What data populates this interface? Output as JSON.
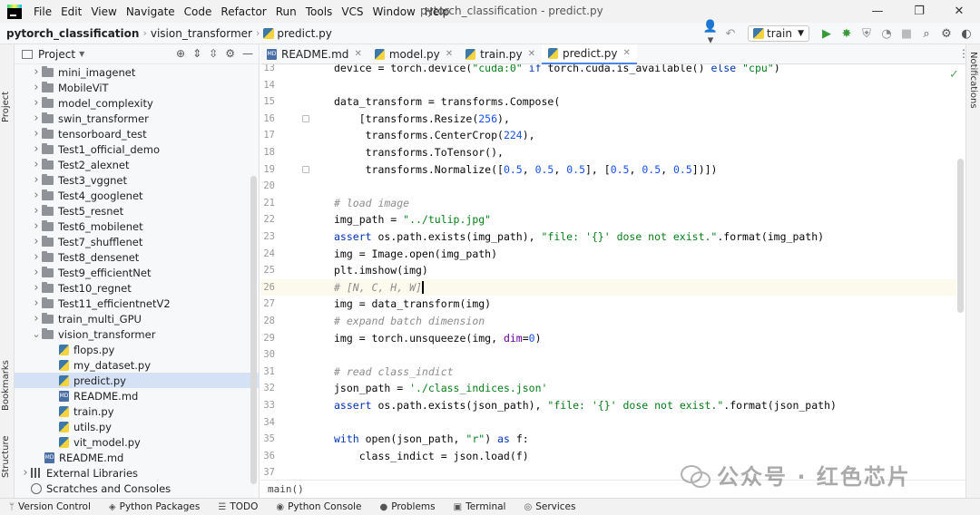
{
  "menubar": {
    "items": [
      "File",
      "Edit",
      "View",
      "Navigate",
      "Code",
      "Refactor",
      "Run",
      "Tools",
      "VCS",
      "Window",
      "Help"
    ],
    "window_title": "pytorch_classification - predict.py"
  },
  "navbar": {
    "project": "pytorch_classification",
    "folder": "vision_transformer",
    "file": "predict.py",
    "run_config": "train"
  },
  "left_strip": {
    "project": "Project",
    "bookmarks": "Bookmarks",
    "structure": "Structure"
  },
  "right_strip": {
    "notifications": "Notifications"
  },
  "project_panel": {
    "title": "Project",
    "tree": [
      {
        "label": "mini_imagenet",
        "type": "folder",
        "depth": 1
      },
      {
        "label": "MobileViT",
        "type": "folder",
        "depth": 1
      },
      {
        "label": "model_complexity",
        "type": "folder",
        "depth": 1
      },
      {
        "label": "swin_transformer",
        "type": "folder",
        "depth": 1
      },
      {
        "label": "tensorboard_test",
        "type": "folder",
        "depth": 1
      },
      {
        "label": "Test1_official_demo",
        "type": "folder",
        "depth": 1
      },
      {
        "label": "Test2_alexnet",
        "type": "folder",
        "depth": 1
      },
      {
        "label": "Test3_vggnet",
        "type": "folder",
        "depth": 1
      },
      {
        "label": "Test4_googlenet",
        "type": "folder",
        "depth": 1
      },
      {
        "label": "Test5_resnet",
        "type": "folder",
        "depth": 1
      },
      {
        "label": "Test6_mobilenet",
        "type": "folder",
        "depth": 1
      },
      {
        "label": "Test7_shufflenet",
        "type": "folder",
        "depth": 1
      },
      {
        "label": "Test8_densenet",
        "type": "folder",
        "depth": 1
      },
      {
        "label": "Test9_efficientNet",
        "type": "folder",
        "depth": 1
      },
      {
        "label": "Test10_regnet",
        "type": "folder",
        "depth": 1
      },
      {
        "label": "Test11_efficientnetV2",
        "type": "folder",
        "depth": 1
      },
      {
        "label": "train_multi_GPU",
        "type": "folder",
        "depth": 1
      },
      {
        "label": "vision_transformer",
        "type": "folder-open",
        "depth": 1
      },
      {
        "label": "flops.py",
        "type": "py",
        "depth": 2
      },
      {
        "label": "my_dataset.py",
        "type": "py",
        "depth": 2
      },
      {
        "label": "predict.py",
        "type": "py",
        "depth": 2,
        "selected": true
      },
      {
        "label": "README.md",
        "type": "md",
        "depth": 2
      },
      {
        "label": "train.py",
        "type": "py",
        "depth": 2
      },
      {
        "label": "utils.py",
        "type": "py",
        "depth": 2
      },
      {
        "label": "vit_model.py",
        "type": "py",
        "depth": 2
      },
      {
        "label": "README.md",
        "type": "md",
        "depth": 1
      },
      {
        "label": "External Libraries",
        "type": "lib",
        "depth": 0
      },
      {
        "label": "Scratches and Consoles",
        "type": "scratch",
        "depth": 0
      }
    ]
  },
  "tabs": [
    {
      "label": "README.md",
      "type": "md",
      "active": false
    },
    {
      "label": "model.py",
      "type": "py",
      "active": false
    },
    {
      "label": "train.py",
      "type": "py",
      "active": false
    },
    {
      "label": "predict.py",
      "type": "py",
      "active": true
    }
  ],
  "editor": {
    "lines": [
      {
        "n": "13",
        "html": "device = torch.device(<span class=\"str\">\"cuda:0\"</span> <span class=\"kw\">if</span> torch.cuda.is_available() <span class=\"kw\">else</span> <span class=\"str\">\"cpu\"</span>)"
      },
      {
        "n": "14",
        "html": ""
      },
      {
        "n": "15",
        "html": "data_transform = transforms.Compose("
      },
      {
        "n": "16",
        "html": "    [transforms.Resize(<span class=\"num\">256</span>),",
        "fold": true
      },
      {
        "n": "17",
        "html": "     transforms.CenterCrop(<span class=\"num\">224</span>),"
      },
      {
        "n": "18",
        "html": "     transforms.ToTensor(),"
      },
      {
        "n": "19",
        "html": "     transforms.Normalize([<span class=\"num\">0.5</span>, <span class=\"num\">0.5</span>, <span class=\"num\">0.5</span>], [<span class=\"num\">0.5</span>, <span class=\"num\">0.5</span>, <span class=\"num\">0.5</span>])])",
        "fold": true
      },
      {
        "n": "20",
        "html": ""
      },
      {
        "n": "21",
        "html": "<span class=\"cmt\"># load image</span>"
      },
      {
        "n": "22",
        "html": "img_path = <span class=\"str\">\"../tulip.jpg\"</span>"
      },
      {
        "n": "23",
        "html": "<span class=\"kw\">assert</span> os.path.exists(img_path), <span class=\"str\">\"file: '{}' dose not exist.\"</span>.format(img_path)"
      },
      {
        "n": "24",
        "html": "img = Image.open(img_path)"
      },
      {
        "n": "25",
        "html": "plt.imshow(img)"
      },
      {
        "n": "26",
        "html": "<span class=\"cmt\"># [N, C, H, W]</span><span class=\"caret\"></span>",
        "current": true
      },
      {
        "n": "27",
        "html": "img = data_transform(img)"
      },
      {
        "n": "28",
        "html": "<span class=\"cmt\"># expand batch dimension</span>"
      },
      {
        "n": "29",
        "html": "img = torch.unsqueeze(img, <span class=\"prm\">dim</span>=<span class=\"num\">0</span>)"
      },
      {
        "n": "30",
        "html": ""
      },
      {
        "n": "31",
        "html": "<span class=\"cmt\"># read class_indict</span>"
      },
      {
        "n": "32",
        "html": "json_path = <span class=\"str\">'./class_indices.json'</span>"
      },
      {
        "n": "33",
        "html": "<span class=\"kw\">assert</span> os.path.exists(json_path), <span class=\"str\">\"file: '{}' dose not exist.\"</span>.format(json_path)"
      },
      {
        "n": "34",
        "html": ""
      },
      {
        "n": "35",
        "html": "<span class=\"kw\">with</span> open(json_path, <span class=\"str\">\"r\"</span>) <span class=\"kw\">as</span> f:"
      },
      {
        "n": "36",
        "html": "    class_indict = json.load(f)"
      },
      {
        "n": "37",
        "html": ""
      }
    ],
    "breadcrumb": "main()"
  },
  "watermark": "公众号 · 红色芯片",
  "statusbar": [
    {
      "label": "Version Control",
      "icon": "branch-icon",
      "glyph": "ᛘ"
    },
    {
      "label": "Python Packages",
      "icon": "packages-icon",
      "glyph": "◈"
    },
    {
      "label": "TODO",
      "icon": "todo-icon",
      "glyph": "☰"
    },
    {
      "label": "Python Console",
      "icon": "python-console-icon",
      "glyph": "◉"
    },
    {
      "label": "Problems",
      "icon": "problems-icon",
      "glyph": "●"
    },
    {
      "label": "Terminal",
      "icon": "terminal-icon",
      "glyph": "▣"
    },
    {
      "label": "Services",
      "icon": "services-icon",
      "glyph": "◎"
    }
  ]
}
